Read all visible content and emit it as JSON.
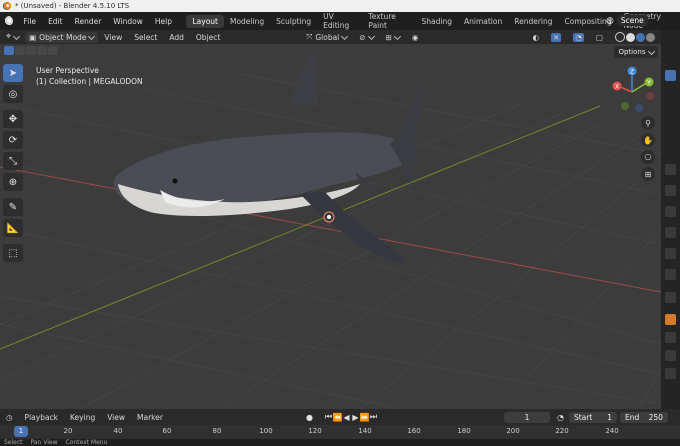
{
  "window": {
    "title": "* (Unsaved) - Blender 4.5.10 LTS"
  },
  "menu": [
    "File",
    "Edit",
    "Render",
    "Window",
    "Help"
  ],
  "workspaces": [
    "Layout",
    "Modeling",
    "Sculpting",
    "UV Editing",
    "Texture Paint",
    "Shading",
    "Animation",
    "Rendering",
    "Compositing",
    "Geometry Node"
  ],
  "active_workspace": "Layout",
  "scene": {
    "label": "Scene"
  },
  "header": {
    "mode": "Object Mode",
    "view": "View",
    "select": "Select",
    "add": "Add",
    "object": "Object",
    "orientation": "Global"
  },
  "viewport": {
    "perspective": "User Perspective",
    "collection": "(1) Collection | MEGALODON",
    "options": "Options"
  },
  "gizmo": {
    "x": "X",
    "y": "Y",
    "z": "Z"
  },
  "timeline": {
    "playback": "Playback",
    "keying": "Keying",
    "view": "View",
    "marker": "Marker",
    "current_frame": "1",
    "start_label": "Start",
    "start": "1",
    "end_label": "End",
    "end": "250",
    "ruler_current": "1",
    "ticks": [
      "20",
      "40",
      "60",
      "80",
      "100",
      "120",
      "140",
      "160",
      "180",
      "200",
      "220",
      "240"
    ]
  },
  "status": [
    "Select",
    "Pan View",
    "Context Menu"
  ],
  "colors": {
    "accent": "#4772b3",
    "x_axis": "#e0524f",
    "y_axis": "#8cbc34",
    "z_axis": "#4489d7"
  }
}
